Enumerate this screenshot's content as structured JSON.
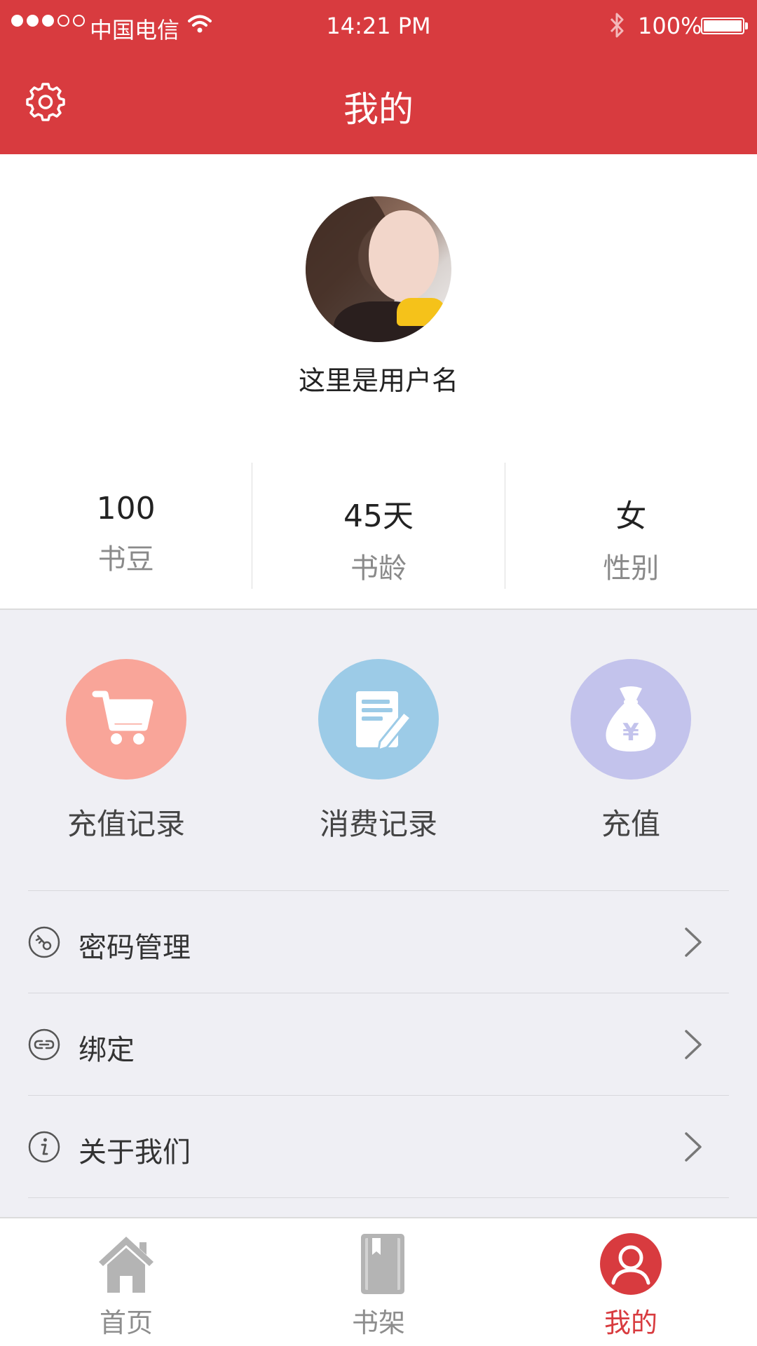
{
  "status_bar": {
    "carrier": "中国电信",
    "time": "14:21 PM",
    "battery": "100%",
    "signal_icon": "signal-dots-icon",
    "wifi_icon": "wifi-icon",
    "bluetooth_icon": "bluetooth-icon",
    "battery_icon": "battery-icon"
  },
  "header": {
    "title": "我的",
    "settings_icon": "gear-icon"
  },
  "profile": {
    "username": "这里是用户名",
    "stats": [
      {
        "value": "100",
        "label": "书豆"
      },
      {
        "value": "45天",
        "label": "书龄"
      },
      {
        "value": "女",
        "label": "性别"
      }
    ]
  },
  "shortcuts": [
    {
      "label": "充值记录",
      "icon": "shopping-cart-icon",
      "color": "#f9a599"
    },
    {
      "label": "消费记录",
      "icon": "note-pencil-icon",
      "color": "#9ccbe7"
    },
    {
      "label": "充值",
      "icon": "money-bag-icon",
      "color": "#c3c3ec"
    }
  ],
  "menu": [
    {
      "label": "密码管理",
      "icon": "key-icon"
    },
    {
      "label": "绑定",
      "icon": "link-icon"
    },
    {
      "label": "关于我们",
      "icon": "info-icon"
    }
  ],
  "tab_bar": [
    {
      "label": "首页",
      "icon": "home-icon",
      "active": false
    },
    {
      "label": "书架",
      "icon": "bookshelf-icon",
      "active": false
    },
    {
      "label": "我的",
      "icon": "user-icon",
      "active": true
    }
  ],
  "colors": {
    "brand_red": "#d83b3f",
    "background": "#efeff4",
    "inactive_tab": "#b4b4b4"
  }
}
